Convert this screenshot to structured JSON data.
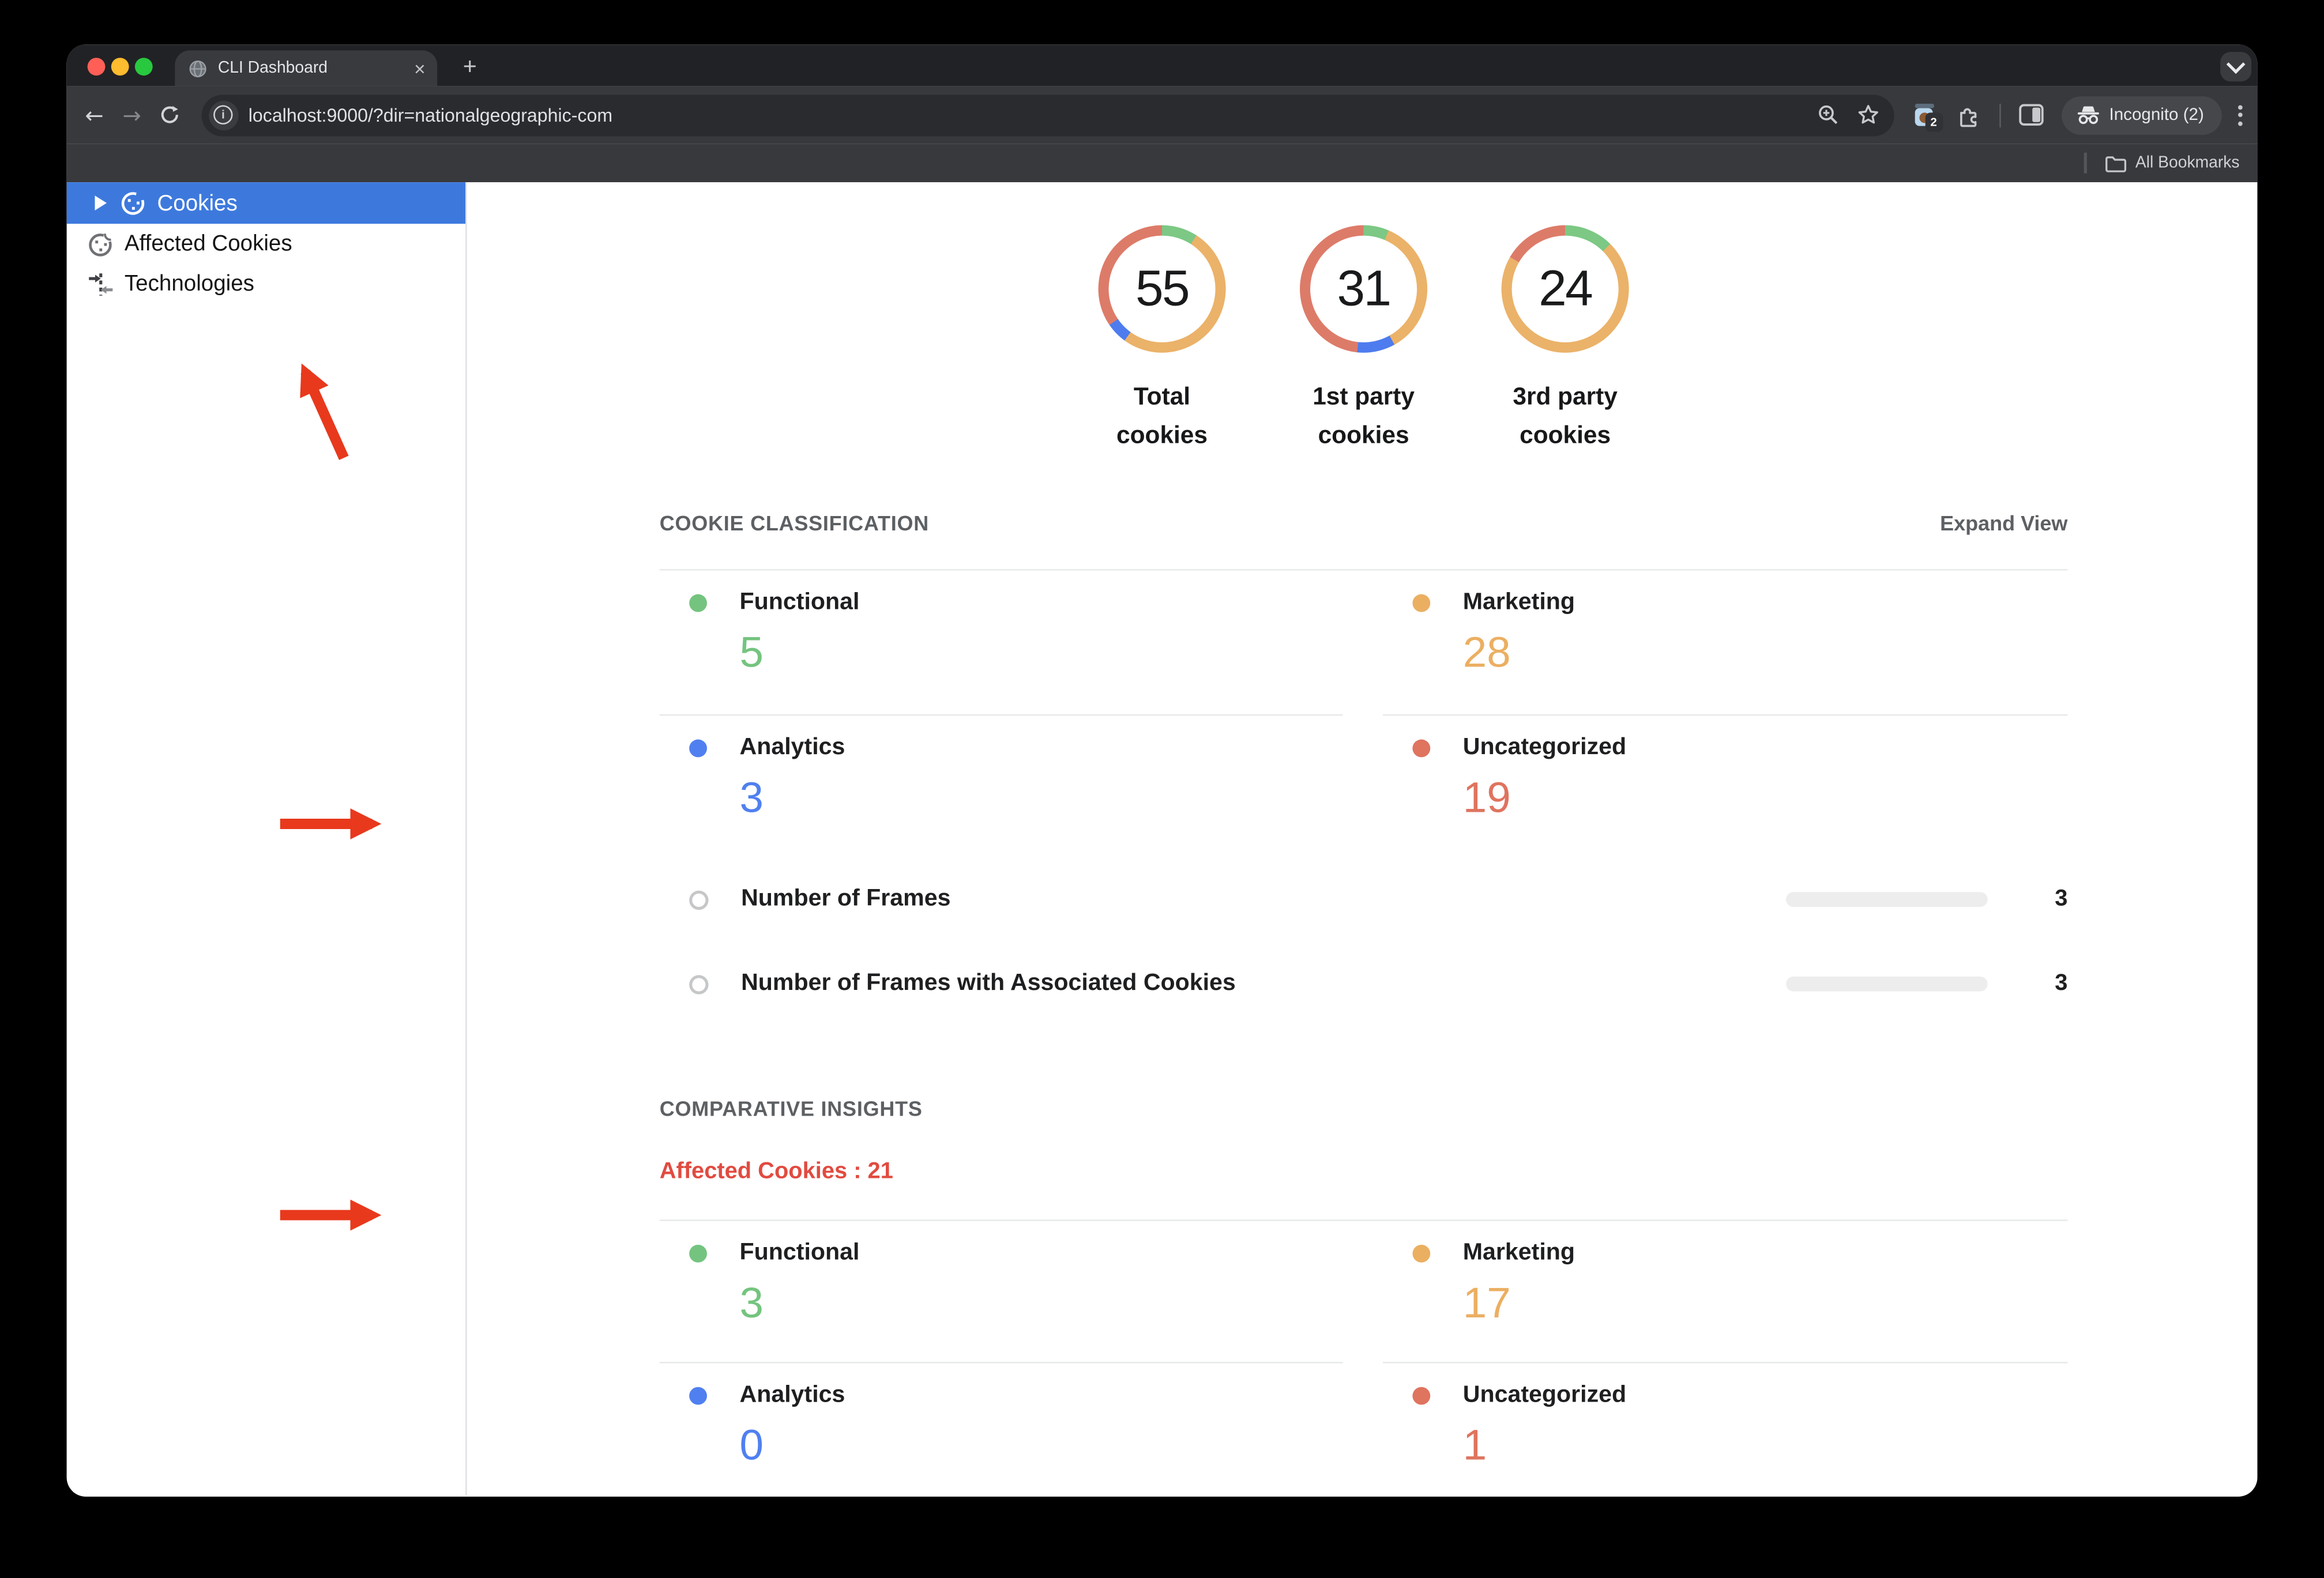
{
  "browser": {
    "tab_title": "CLI Dashboard",
    "url": "localhost:9000/?dir=nationalgeographic-com",
    "extension_badge": "2",
    "incognito_label": "Incognito (2)",
    "all_bookmarks_label": "All Bookmarks",
    "new_tab_glyph": "+",
    "close_tab_glyph": "×",
    "back_glyph": "←",
    "forward_glyph": "→"
  },
  "sidebar": {
    "items": [
      {
        "label": "Cookies",
        "selected": true
      },
      {
        "label": "Affected Cookies",
        "selected": false
      },
      {
        "label": "Technologies",
        "selected": false
      }
    ],
    "selected_bg": "#3D79DD"
  },
  "classification": {
    "title": "COOKIE CLASSIFICATION",
    "expand_label": "Expand View",
    "items": [
      {
        "label": "Functional",
        "value": "5",
        "color": "#74C47F"
      },
      {
        "label": "Marketing",
        "value": "28",
        "color": "#EBAF62"
      },
      {
        "label": "Analytics",
        "value": "3",
        "color": "#5080F0"
      },
      {
        "label": "Uncategorized",
        "value": "19",
        "color": "#DF745F"
      }
    ],
    "frames": [
      {
        "label": "Number of Frames",
        "value": "3"
      },
      {
        "label": "Number of Frames with Associated Cookies",
        "value": "3"
      }
    ]
  },
  "comparative": {
    "title": "COMPARATIVE INSIGHTS",
    "affected_label": "Affected Cookies : 21",
    "affected_color": "#E14B40",
    "items": [
      {
        "label": "Functional",
        "value": "3",
        "color": "#74C47F"
      },
      {
        "label": "Marketing",
        "value": "17",
        "color": "#EBAF62"
      },
      {
        "label": "Analytics",
        "value": "0",
        "color": "#5080F0"
      },
      {
        "label": "Uncategorized",
        "value": "1",
        "color": "#DF745F"
      }
    ]
  },
  "chart_data": [
    {
      "type": "donut",
      "title": "Total cookies",
      "total": 55,
      "segments": [
        {
          "label": "Functional",
          "value": 5,
          "color": "#7CC884"
        },
        {
          "label": "Marketing",
          "value": 28,
          "color": "#EBB269"
        },
        {
          "label": "Analytics",
          "value": 3,
          "color": "#4E7CEF"
        },
        {
          "label": "Uncategorized",
          "value": 19,
          "color": "#DD7B69"
        }
      ]
    },
    {
      "type": "donut",
      "title": "1st party cookies",
      "total": 31,
      "segments": [
        {
          "label": "Functional",
          "value": 2,
          "color": "#7CC884"
        },
        {
          "label": "Marketing",
          "value": 11,
          "color": "#EBB269"
        },
        {
          "label": "Analytics",
          "value": 3,
          "color": "#4E7CEF"
        },
        {
          "label": "Uncategorized",
          "value": 15,
          "color": "#DD7B69"
        }
      ]
    },
    {
      "type": "donut",
      "title": "3rd party cookies",
      "total": 24,
      "segments": [
        {
          "label": "Functional",
          "value": 3,
          "color": "#7CC884"
        },
        {
          "label": "Marketing",
          "value": 17,
          "color": "#EBB269"
        },
        {
          "label": "Analytics",
          "value": 0,
          "color": "#4E7CEF"
        },
        {
          "label": "Uncategorized",
          "value": 4,
          "color": "#DD7B69"
        }
      ]
    }
  ],
  "annotations": {
    "arrow_color": "#E8391D"
  }
}
